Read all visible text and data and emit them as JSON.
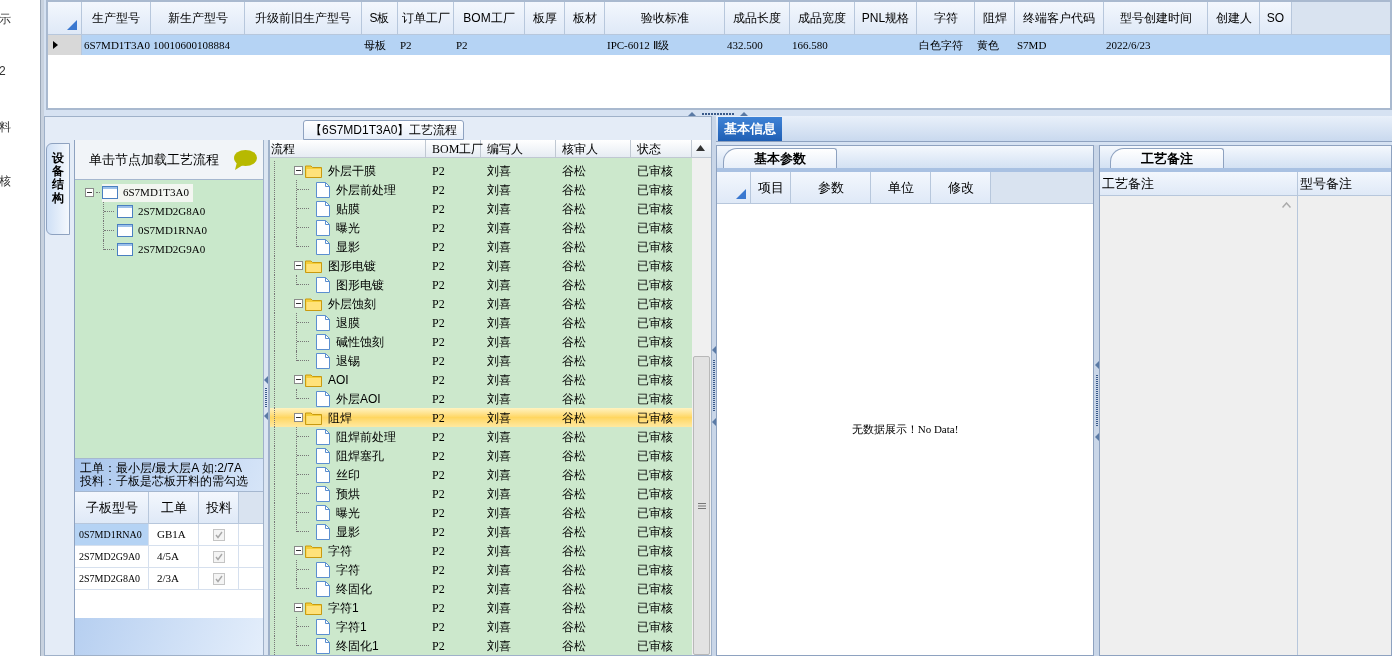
{
  "left_edge_labels": [
    "示",
    "2",
    "料",
    "核"
  ],
  "top_grid": {
    "columns": [
      "生产型号",
      "新生产型号",
      "升级前旧生产型号",
      "S板",
      "订单工厂",
      "BOM工厂",
      "板厚",
      "板材",
      "验收标准",
      "成品长度",
      "成品宽度",
      "PNL规格",
      "字符",
      "阻焊",
      "终端客户代码",
      "型号创建时间",
      "创建人",
      "SO"
    ],
    "rows": [
      {
        "selected": true,
        "cells": [
          "6S7MD1T3A0",
          "10010600108884",
          null,
          "母板",
          "P2",
          "P2",
          null,
          null,
          "IPC-6012 Ⅱ级",
          "432.500",
          "166.580",
          null,
          "白色字符",
          "黄色",
          "S7MD",
          "2022/6/23",
          null,
          null
        ]
      }
    ]
  },
  "process_tab": {
    "title": "【6S7MD1T3A0】工艺流程"
  },
  "side_tab": {
    "label": "设备结构",
    "selected": true
  },
  "structure": {
    "hint": "单击节点加载工艺流程",
    "tree": [
      {
        "label": "6S7MD1T3A0",
        "selected": true,
        "expanded": true,
        "children": [
          {
            "label": "2S7MD2G8A0",
            "selected": false
          },
          {
            "label": "0S7MD1RNA0",
            "selected": false
          },
          {
            "label": "2S7MD2G9A0",
            "selected": false
          }
        ]
      }
    ]
  },
  "notes": [
    "工单：最小层/最大层A 如:2/7A",
    "投料：子板是芯板开料的需勾选"
  ],
  "sub_board_grid": {
    "columns": [
      "子板型号",
      "工单",
      "投料"
    ],
    "rows": [
      {
        "cells": [
          "0S7MD1RNA0",
          "GB1A"
        ],
        "checked": true,
        "selected": true
      },
      {
        "cells": [
          "2S7MD2G9A0",
          "4/5A"
        ],
        "checked": true,
        "selected": false
      },
      {
        "cells": [
          "2S7MD2G8A0",
          "2/3A"
        ],
        "checked": true,
        "selected": false
      }
    ]
  },
  "flow_grid": {
    "columns": [
      "流程",
      "BOM工厂",
      "编写人",
      "核审人",
      "状态"
    ],
    "rows": [
      {
        "kind": "folder",
        "expanded": true,
        "selected": false,
        "cells": [
          "外层干膜",
          "P2",
          "刘喜",
          "谷松",
          "已审核"
        ],
        "children": [
          {
            "kind": "step",
            "selected": false,
            "cells": [
              "外层前处理",
              "P2",
              "刘喜",
              "谷松",
              "已审核"
            ]
          },
          {
            "kind": "step",
            "selected": false,
            "cells": [
              "贴膜",
              "P2",
              "刘喜",
              "谷松",
              "已审核"
            ]
          },
          {
            "kind": "step",
            "selected": false,
            "cells": [
              "曝光",
              "P2",
              "刘喜",
              "谷松",
              "已审核"
            ]
          },
          {
            "kind": "step",
            "selected": false,
            "cells": [
              "显影",
              "P2",
              "刘喜",
              "谷松",
              "已审核"
            ]
          }
        ]
      },
      {
        "kind": "folder",
        "expanded": true,
        "selected": false,
        "cells": [
          "图形电镀",
          "P2",
          "刘喜",
          "谷松",
          "已审核"
        ],
        "children": [
          {
            "kind": "step",
            "selected": false,
            "cells": [
              "图形电镀",
              "P2",
              "刘喜",
              "谷松",
              "已审核"
            ]
          }
        ]
      },
      {
        "kind": "folder",
        "expanded": true,
        "selected": false,
        "cells": [
          "外层蚀刻",
          "P2",
          "刘喜",
          "谷松",
          "已审核"
        ],
        "children": [
          {
            "kind": "step",
            "selected": false,
            "cells": [
              "退膜",
              "P2",
              "刘喜",
              "谷松",
              "已审核"
            ]
          },
          {
            "kind": "step",
            "selected": false,
            "cells": [
              "碱性蚀刻",
              "P2",
              "刘喜",
              "谷松",
              "已审核"
            ]
          },
          {
            "kind": "step",
            "selected": false,
            "cells": [
              "退锡",
              "P2",
              "刘喜",
              "谷松",
              "已审核"
            ]
          }
        ]
      },
      {
        "kind": "folder",
        "expanded": true,
        "selected": false,
        "cells": [
          "AOI",
          "P2",
          "刘喜",
          "谷松",
          "已审核"
        ],
        "children": [
          {
            "kind": "step",
            "selected": false,
            "cells": [
              "外层AOI",
              "P2",
              "刘喜",
              "谷松",
              "已审核"
            ]
          }
        ]
      },
      {
        "kind": "folder",
        "expanded": true,
        "selected": true,
        "cells": [
          "阻焊",
          "P2",
          "刘喜",
          "谷松",
          "已审核"
        ],
        "children": [
          {
            "kind": "step",
            "selected": false,
            "cells": [
              "阻焊前处理",
              "P2",
              "刘喜",
              "谷松",
              "已审核"
            ]
          },
          {
            "kind": "step",
            "selected": false,
            "cells": [
              "阻焊塞孔",
              "P2",
              "刘喜",
              "谷松",
              "已审核"
            ]
          },
          {
            "kind": "step",
            "selected": false,
            "cells": [
              "丝印",
              "P2",
              "刘喜",
              "谷松",
              "已审核"
            ]
          },
          {
            "kind": "step",
            "selected": false,
            "cells": [
              "预烘",
              "P2",
              "刘喜",
              "谷松",
              "已审核"
            ]
          },
          {
            "kind": "step",
            "selected": false,
            "cells": [
              "曝光",
              "P2",
              "刘喜",
              "谷松",
              "已审核"
            ]
          },
          {
            "kind": "step",
            "selected": false,
            "cells": [
              "显影",
              "P2",
              "刘喜",
              "谷松",
              "已审核"
            ]
          }
        ]
      },
      {
        "kind": "folder",
        "expanded": true,
        "selected": false,
        "cells": [
          "字符",
          "P2",
          "刘喜",
          "谷松",
          "已审核"
        ],
        "children": [
          {
            "kind": "step",
            "selected": false,
            "cells": [
              "字符",
              "P2",
              "刘喜",
              "谷松",
              "已审核"
            ]
          },
          {
            "kind": "step",
            "selected": false,
            "cells": [
              "终固化",
              "P2",
              "刘喜",
              "谷松",
              "已审核"
            ]
          }
        ]
      },
      {
        "kind": "folder",
        "expanded": true,
        "selected": false,
        "cells": [
          "字符1",
          "P2",
          "刘喜",
          "谷松",
          "已审核"
        ],
        "children": [
          {
            "kind": "step",
            "selected": false,
            "cells": [
              "字符1",
              "P2",
              "刘喜",
              "谷松",
              "已审核"
            ]
          },
          {
            "kind": "step",
            "selected": false,
            "cells": [
              "终固化1",
              "P2",
              "刘喜",
              "谷松",
              "已审核"
            ]
          }
        ]
      }
    ]
  },
  "info_tab": {
    "label": "基本信息",
    "selected": true
  },
  "params": {
    "tab": "基本参数",
    "columns": [
      "项目",
      "参数",
      "单位",
      "修改"
    ],
    "empty_text": "无数据展示！No Data!"
  },
  "remarks": {
    "tab": "工艺备注",
    "columns": [
      "工艺备注",
      "型号备注"
    ]
  }
}
